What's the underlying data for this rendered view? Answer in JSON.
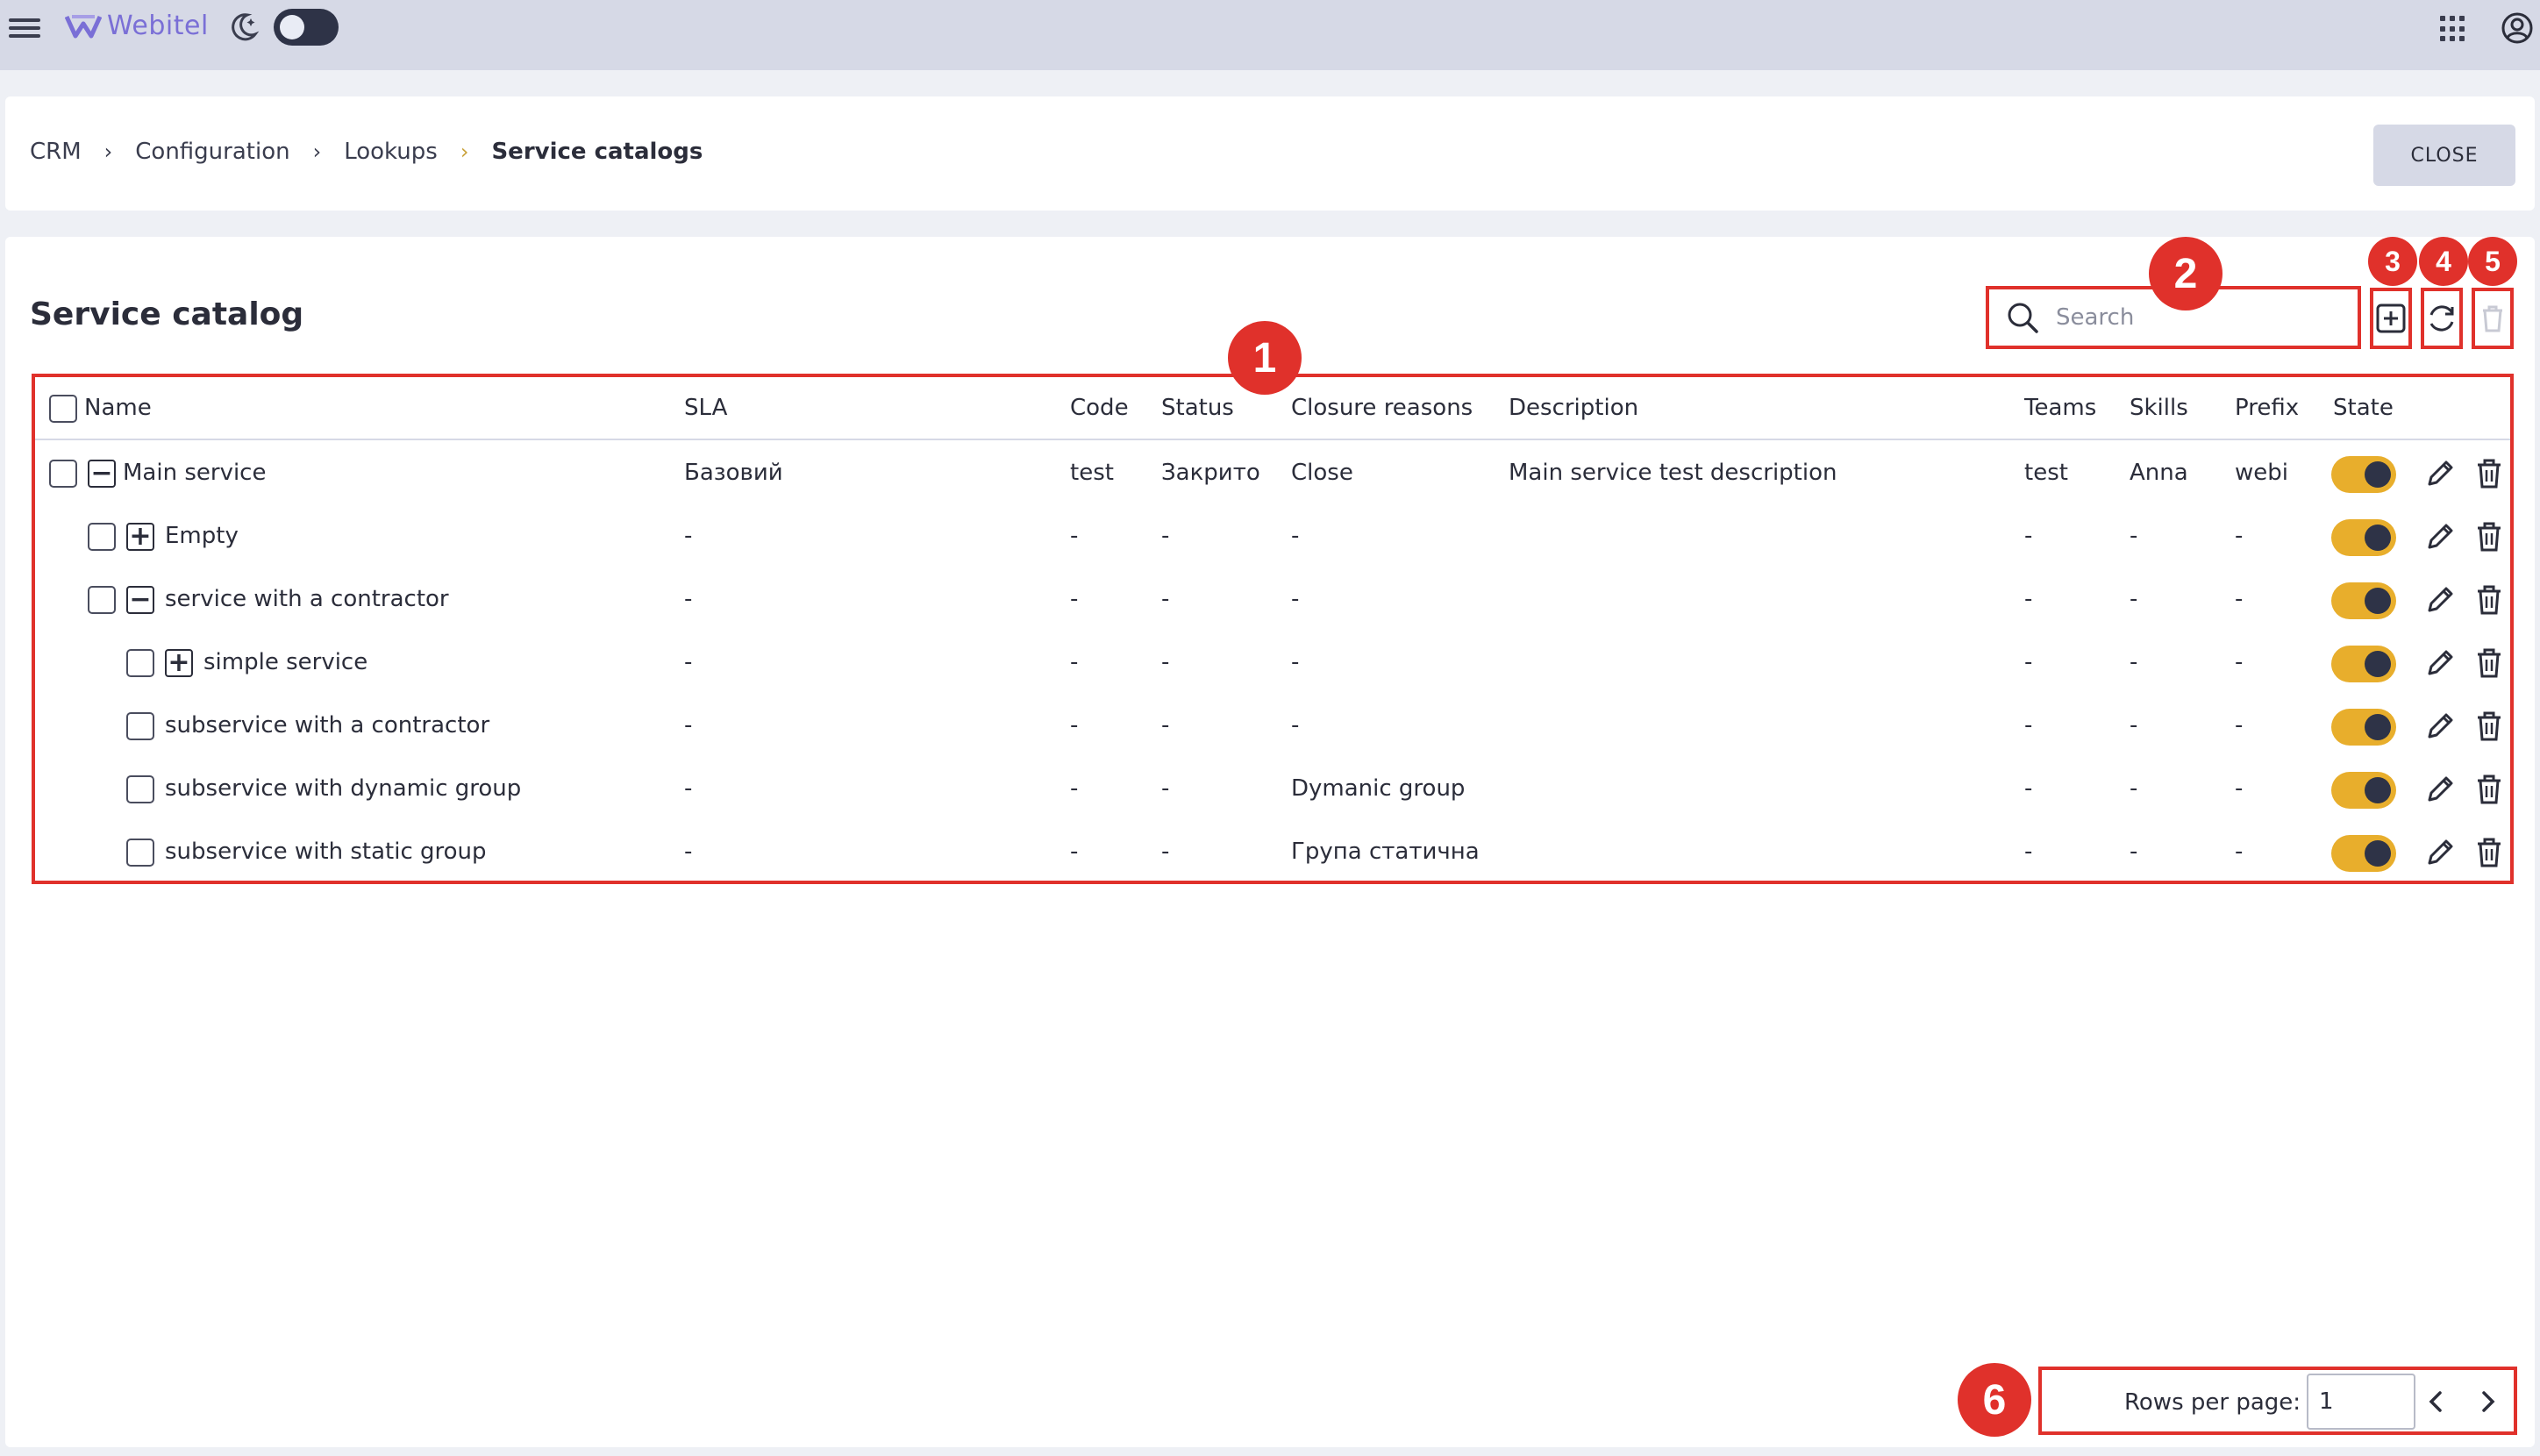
{
  "header": {
    "logo_text": "Webitel",
    "icons": [
      "hamburger-icon",
      "webitel-logo-icon",
      "moon-icon",
      "apps-grid-icon",
      "account-icon"
    ],
    "theme_toggle_on": false
  },
  "breadcrumb": {
    "items": [
      "CRM",
      "Configuration",
      "Lookups"
    ],
    "current": "Service catalogs",
    "sep": "›"
  },
  "close_label": "CLOSE",
  "page_title": "Service catalog",
  "search": {
    "placeholder": "Search",
    "value": ""
  },
  "tools": {
    "icons": [
      "add-icon",
      "refresh-icon",
      "delete-icon"
    ]
  },
  "annotations": [
    "1",
    "2",
    "3",
    "4",
    "5",
    "6"
  ],
  "colors": {
    "accent_red": "#e0312b",
    "toggle_on": "#e8ae2c",
    "topbar": "#d6d9e6",
    "logo": "#7a6fd6"
  },
  "table": {
    "columns": [
      "Name",
      "SLA",
      "Code",
      "Status",
      "Closure reasons",
      "Description",
      "Teams",
      "Skills",
      "Prefix",
      "State"
    ],
    "rows": [
      {
        "name": "Main service",
        "sla": "Базовий",
        "code": "test",
        "status": "Закрито",
        "closure": "Close",
        "description": "Main service test description",
        "teams": "test",
        "skills": "Anna",
        "prefix": "webi",
        "state": true,
        "level": 0,
        "expander": "minus"
      },
      {
        "name": "Empty",
        "sla": "-",
        "code": "-",
        "status": "-",
        "closure": "-",
        "description": "",
        "teams": "-",
        "skills": "-",
        "prefix": "-",
        "state": true,
        "level": 1,
        "expander": "plus"
      },
      {
        "name": "service with a contractor",
        "sla": "-",
        "code": "-",
        "status": "-",
        "closure": "-",
        "description": "",
        "teams": "-",
        "skills": "-",
        "prefix": "-",
        "state": true,
        "level": 1,
        "expander": "minus"
      },
      {
        "name": "simple service",
        "sla": "-",
        "code": "-",
        "status": "-",
        "closure": "-",
        "description": "",
        "teams": "-",
        "skills": "-",
        "prefix": "-",
        "state": true,
        "level": 2,
        "expander": "plus"
      },
      {
        "name": "subservice with a contractor",
        "sla": "-",
        "code": "-",
        "status": "-",
        "closure": "-",
        "description": "",
        "teams": "-",
        "skills": "-",
        "prefix": "-",
        "state": true,
        "level": 2,
        "expander": "none"
      },
      {
        "name": "subservice with dynamic group",
        "sla": "-",
        "code": "-",
        "status": "-",
        "closure": "Dymanic group",
        "description": "",
        "teams": "-",
        "skills": "-",
        "prefix": "-",
        "state": true,
        "level": 2,
        "expander": "none"
      },
      {
        "name": "subservice with static group",
        "sla": "-",
        "code": "-",
        "status": "-",
        "closure": "Група статична",
        "description": "",
        "teams": "-",
        "skills": "-",
        "prefix": "-",
        "state": true,
        "level": 2,
        "expander": "none"
      }
    ]
  },
  "pagination": {
    "label": "Rows per page:",
    "value": "1"
  }
}
